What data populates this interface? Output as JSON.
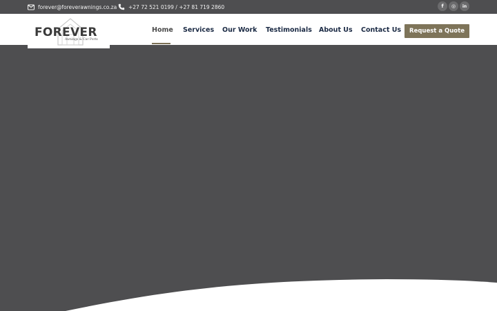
{
  "topbar": {
    "email": "forever@foreverawnings.co.za",
    "phone": "+27 72 521 0199 / +27 81 719 2860",
    "socials": [
      {
        "icon": "facebook-icon",
        "glyph": "f"
      },
      {
        "icon": "instagram-icon",
        "glyph": "◎"
      },
      {
        "icon": "linkedin-icon",
        "glyph": "in"
      }
    ]
  },
  "logo": {
    "word": "FOREVER",
    "sub": "Awnings & Car Ports"
  },
  "nav": {
    "items": [
      "Home",
      "Services",
      "Our Work",
      "Testimonials",
      "About Us",
      "Contact Us"
    ],
    "active": "Home",
    "cta": "Request a Quote"
  },
  "colors": {
    "topbar_bg": "#4e4e50",
    "hero_bg": "#4e4e50",
    "nav_text": "#1b2a44",
    "accent": "#7e7459",
    "wave": "#ffffff"
  }
}
